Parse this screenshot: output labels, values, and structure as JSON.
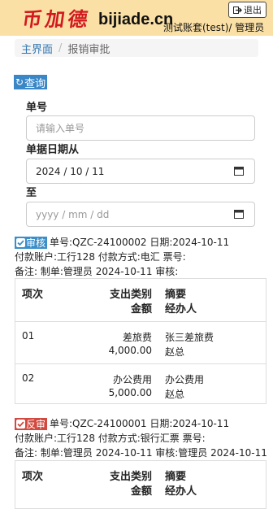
{
  "header": {
    "logo_cn": "币加德",
    "logo_en": "bijiade.cn",
    "account": "测试账套(test)/ 管理员",
    "logout_label": "退出"
  },
  "breadcrumb": {
    "home": "主界面",
    "current": "报销审批"
  },
  "query": {
    "button_label": "查询"
  },
  "form": {
    "order_no_label": "单号",
    "order_no_placeholder": "请输入单号",
    "date_from_label": "单据日期从",
    "date_from_value": "2024 / 10 / 11",
    "date_to_label": "至",
    "date_to_placeholder": "yyyy / mm / dd"
  },
  "records": [
    {
      "status": "审核",
      "line1": "单号:QZC-24100002 日期:2024-10-11",
      "line2": "付款账户:工行128 付款方式:电汇 票号:",
      "line3": "备注: 制单:管理员 2024-10-11 审核:",
      "headers": {
        "item": "项次",
        "category": "支出类别",
        "amount": "金额",
        "summary": "摘要",
        "handler": "经办人"
      },
      "items": [
        {
          "item": "01",
          "category": "差旅费",
          "amount": "4,000.00",
          "summary": "张三差旅费",
          "handler": "赵总"
        },
        {
          "item": "02",
          "category": "办公费用",
          "amount": "5,000.00",
          "summary": "办公费用",
          "handler": "赵总"
        }
      ]
    },
    {
      "status": "反审",
      "line1": "单号:QZC-24100001 日期:2024-10-11",
      "line2": "付款账户:工行128 付款方式:银行汇票 票号:",
      "line3": "备注: 制单:管理员 2024-10-11 审核:管理员 2024-10-11",
      "headers": {
        "item": "项次",
        "category": "支出类别",
        "amount": "金额",
        "summary": "摘要",
        "handler": "经办人"
      }
    }
  ]
}
